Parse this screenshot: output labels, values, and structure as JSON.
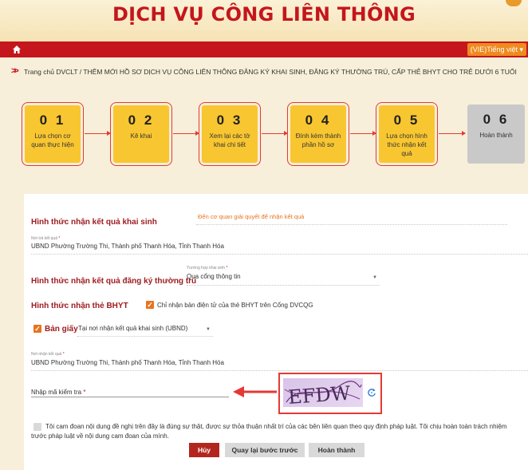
{
  "header": {
    "title": "DỊCH VỤ CÔNG LIÊN THÔNG",
    "language": "(VIE)Tiếng việt"
  },
  "breadcrumb": "Trang chủ DVCLT / THÊM MỚI HỒ SƠ DỊCH VỤ CÔNG LIÊN THÔNG ĐĂNG KÝ KHAI SINH, ĐĂNG KÝ THƯỜNG TRÚ, CẤP THẺ BHYT CHO TRẺ DƯỚI 6 TUỔI",
  "steps": [
    {
      "num": "0 1",
      "label": "Lựa chọn cơ quan thực hiện"
    },
    {
      "num": "0 2",
      "label": "Kê khai"
    },
    {
      "num": "0 3",
      "label": "Xem lại các tờ khai chi tiết"
    },
    {
      "num": "0 4",
      "label": "Đính kèm thành phần hồ sơ"
    },
    {
      "num": "0 5",
      "label": "Lựa chọn hình thức nhận kết quả"
    },
    {
      "num": "0 6",
      "label": "Hoàn thành"
    }
  ],
  "form": {
    "birth_result_label": "Hình thức nhận kết quả khai sinh",
    "birth_result_value": "Đến cơ quan giải quyết để nhận kết quả",
    "return_place_label": "Nơi trả kết quả",
    "return_place_value": "UBND Phường Trường Thi, Thành phố Thanh Hóa, Tỉnh Thanh Hóa",
    "residence_label": "Hình thức nhận kết quả đăng ký thường trú",
    "residence_case_label": "Trường hợp khai sinh",
    "residence_case_value": "Qua cổng thông tin",
    "bhyt_label": "Hình thức nhận thẻ BHYT",
    "bhyt_electronic_text": "Chỉ nhận bản điện tử của thẻ BHYT trên Cổng DVCQG",
    "paper_label": "Bản giấy",
    "paper_select_value": "Tại nơi nhận kết quả khai sinh (UBND)",
    "receive_place_label": "Nơi nhận kết quả",
    "receive_place_value": "UBND Phường Trường Thi, Thành phố Thanh Hóa, Tỉnh Thanh Hóa",
    "captcha_label": "Nhập mã kiểm tra",
    "captcha_text": "EFDW",
    "commitment": "Tôi cam đoan nội dung đề nghị trên đây là đúng sự thật, được sự thỏa thuận nhất trí của các bên liên quan theo quy định pháp luật. Tôi chịu hoàn toàn trách nhiệm trước pháp luật về nội dung cam đoan của mình."
  },
  "buttons": {
    "cancel": "Hủy",
    "back": "Quay lại bước trước",
    "finish": "Hoàn thành"
  },
  "colors": {
    "brand_red": "#c4161c",
    "step_yellow": "#f8c630",
    "accent_orange": "#e8731d"
  }
}
